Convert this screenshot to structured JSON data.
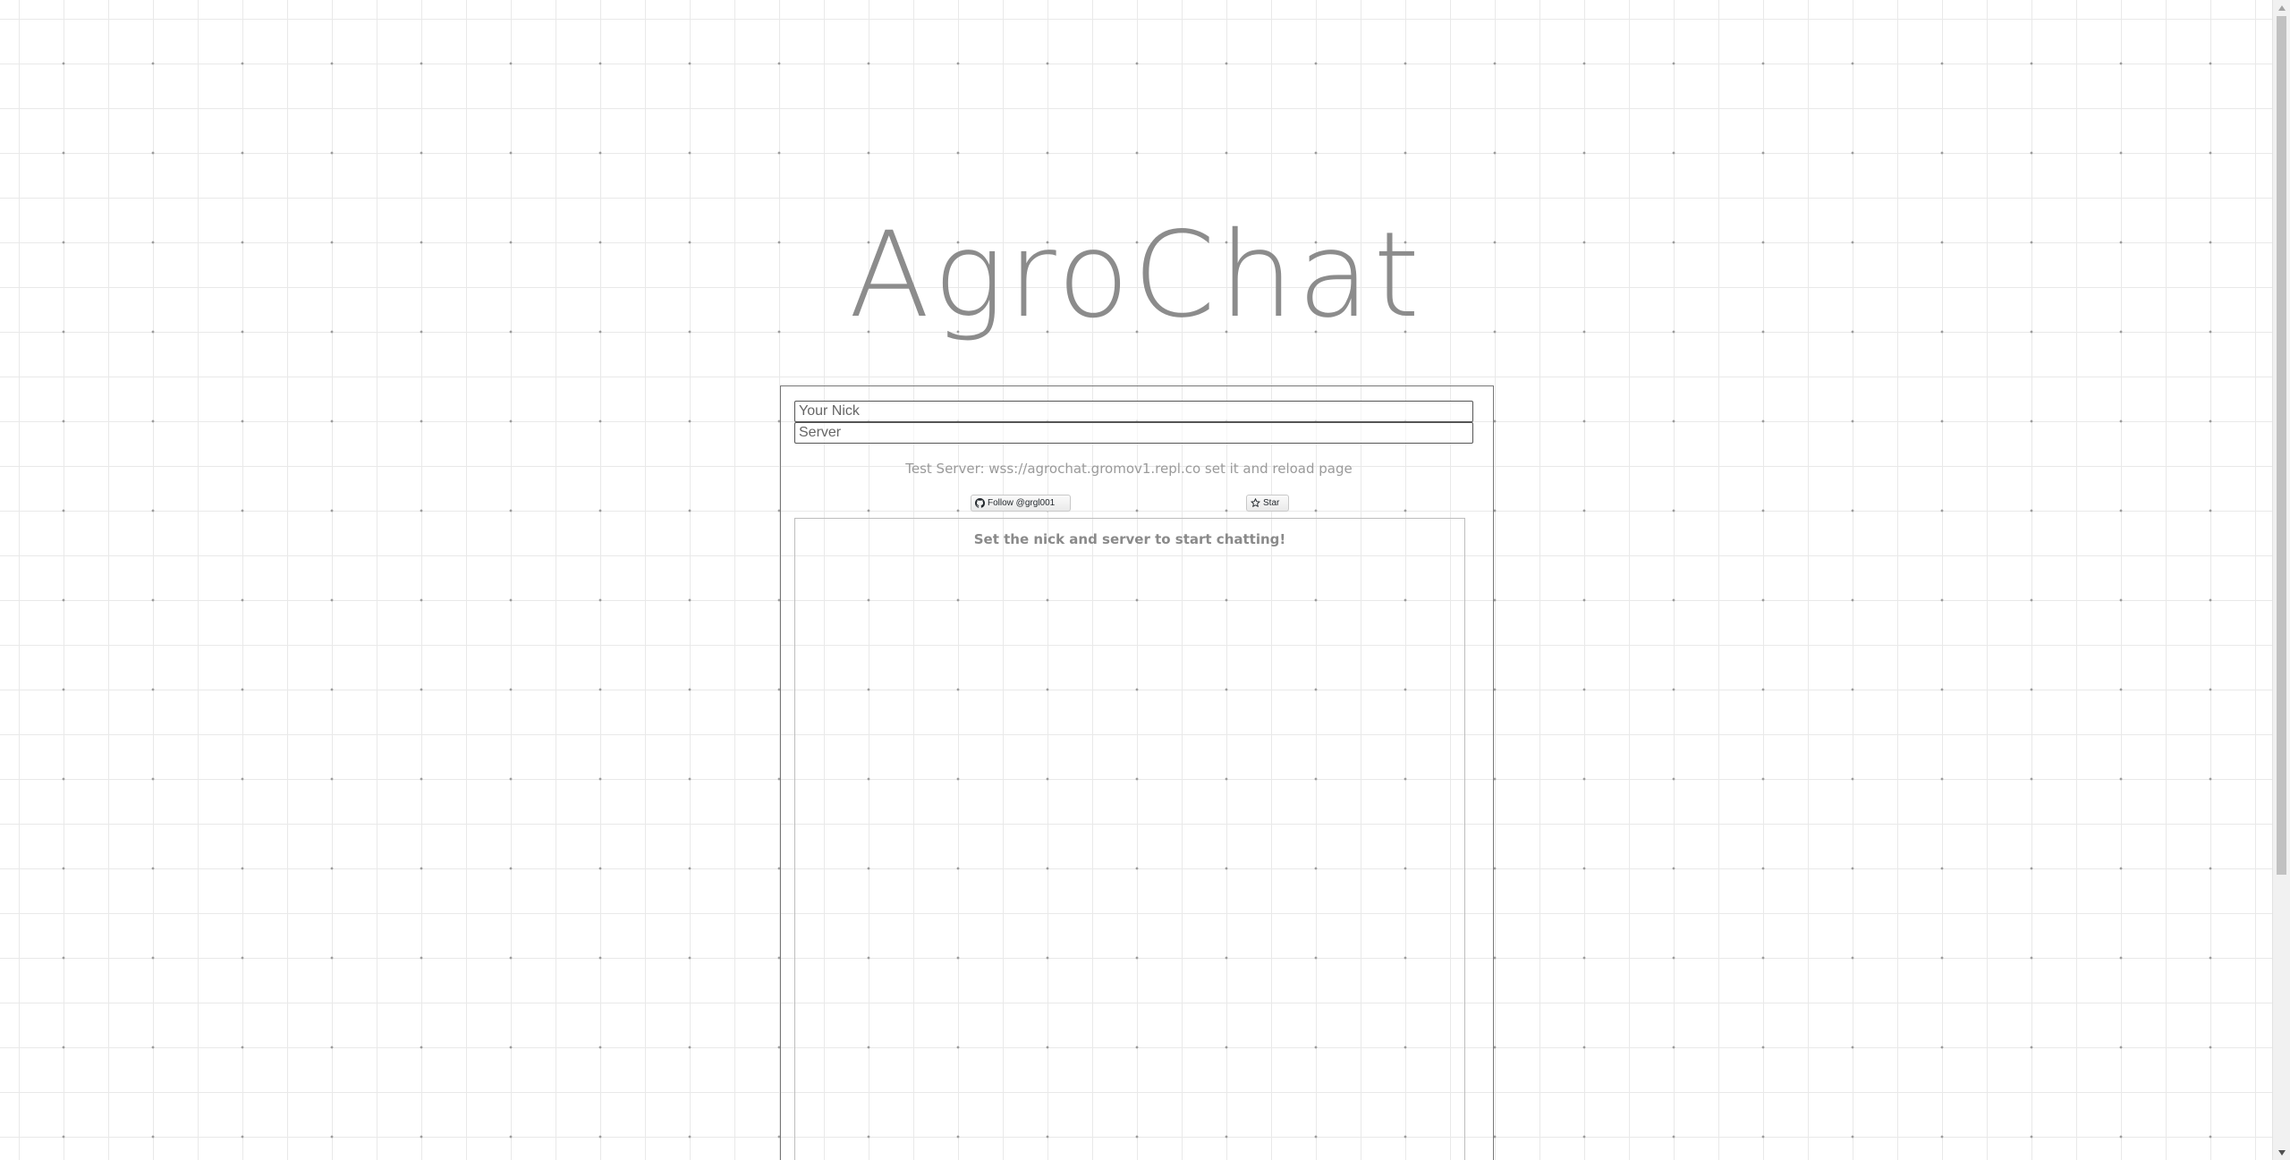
{
  "app": {
    "title": "AgroChat"
  },
  "form": {
    "nick_placeholder": "Your Nick",
    "nick_value": "",
    "server_placeholder": "Server",
    "server_value": ""
  },
  "info": {
    "test_server_note": "Test Server: wss://agrochat.gromov1.repl.co set it and reload page"
  },
  "github": {
    "follow_label": "Follow @grgl001",
    "star_label": "Star"
  },
  "chat": {
    "empty_message": "Set the nick and server to start chatting!"
  },
  "icons": {
    "github": "github-icon",
    "star": "star-icon"
  }
}
